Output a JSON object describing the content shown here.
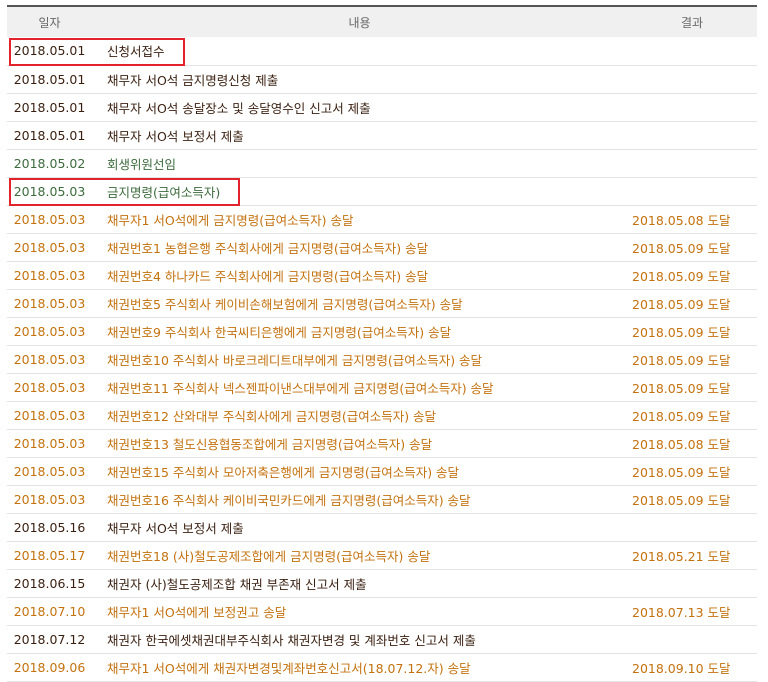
{
  "headers": {
    "date": "일자",
    "content": "내용",
    "result": "결과"
  },
  "colors": {
    "dark": "#3a1f10",
    "green": "#3d6b3d",
    "orange": "#c4720f",
    "highlight": "#e3232c",
    "header_border": "#555555"
  },
  "rows": [
    {
      "date": "2018.05.01",
      "content": "신청서접수",
      "result": "",
      "tone": "dark",
      "highlighted": true
    },
    {
      "date": "2018.05.01",
      "content": "채무자 서O석 금지명령신청 제출",
      "result": "",
      "tone": "dark"
    },
    {
      "date": "2018.05.01",
      "content": "채무자 서O석 송달장소 및 송달영수인 신고서 제출",
      "result": "",
      "tone": "dark"
    },
    {
      "date": "2018.05.01",
      "content": "채무자 서O석 보정서 제출",
      "result": "",
      "tone": "dark"
    },
    {
      "date": "2018.05.02",
      "content": "회생위원선임",
      "result": "",
      "tone": "green"
    },
    {
      "date": "2018.05.03",
      "content": "금지명령(급여소득자)",
      "result": "",
      "tone": "green",
      "highlighted": true
    },
    {
      "date": "2018.05.03",
      "content": "채무자1 서O석에게 금지명령(급여소득자) 송달",
      "result": "2018.05.08 도달",
      "tone": "orange"
    },
    {
      "date": "2018.05.03",
      "content": "채권번호1 농협은행 주식회사에게 금지명령(급여소득자) 송달",
      "result": "2018.05.09 도달",
      "tone": "orange"
    },
    {
      "date": "2018.05.03",
      "content": "채권번호4 하나카드 주식회사에게 금지명령(급여소득자) 송달",
      "result": "2018.05.09 도달",
      "tone": "orange"
    },
    {
      "date": "2018.05.03",
      "content": "채권번호5 주식회사 케이비손해보험에게 금지명령(급여소득자) 송달",
      "result": "2018.05.09 도달",
      "tone": "orange"
    },
    {
      "date": "2018.05.03",
      "content": "채권번호9 주식회사 한국씨티은행에게 금지명령(급여소득자) 송달",
      "result": "2018.05.09 도달",
      "tone": "orange"
    },
    {
      "date": "2018.05.03",
      "content": "채권번호10 주식회사 바로크레디트대부에게 금지명령(급여소득자) 송달",
      "result": "2018.05.09 도달",
      "tone": "orange"
    },
    {
      "date": "2018.05.03",
      "content": "채권번호11 주식회사 넥스젠파이낸스대부에게 금지명령(급여소득자) 송달",
      "result": "2018.05.09 도달",
      "tone": "orange"
    },
    {
      "date": "2018.05.03",
      "content": "채권번호12 산와대부 주식회사에게 금지명령(급여소득자) 송달",
      "result": "2018.05.09 도달",
      "tone": "orange"
    },
    {
      "date": "2018.05.03",
      "content": "채권번호13 철도신용협동조합에게 금지명령(급여소득자) 송달",
      "result": "2018.05.08 도달",
      "tone": "orange"
    },
    {
      "date": "2018.05.03",
      "content": "채권번호15 주식회사 모아저축은행에게 금지명령(급여소득자) 송달",
      "result": "2018.05.09 도달",
      "tone": "orange"
    },
    {
      "date": "2018.05.03",
      "content": "채권번호16 주식회사 케이비국민카드에게 금지명령(급여소득자) 송달",
      "result": "2018.05.09 도달",
      "tone": "orange"
    },
    {
      "date": "2018.05.16",
      "content": "채무자 서O석 보정서 제출",
      "result": "",
      "tone": "dark"
    },
    {
      "date": "2018.05.17",
      "content": "채권번호18 (사)철도공제조합에게 금지명령(급여소득자) 송달",
      "result": "2018.05.21 도달",
      "tone": "orange"
    },
    {
      "date": "2018.06.15",
      "content": "채권자 (사)철도공제조합 채권 부존재 신고서 제출",
      "result": "",
      "tone": "dark"
    },
    {
      "date": "2018.07.10",
      "content": "채무자1 서O석에게 보정권고 송달",
      "result": "2018.07.13 도달",
      "tone": "orange"
    },
    {
      "date": "2018.07.12",
      "content": "채권자 한국에셋채권대부주식회사 채권자변경 및 계좌번호 신고서 제출",
      "result": "",
      "tone": "dark"
    },
    {
      "date": "2018.09.06",
      "content": "채무자1 서O석에게 채권자변경및계좌번호신고서(18.07.12.자) 송달",
      "result": "2018.09.10 도달",
      "tone": "orange"
    }
  ]
}
